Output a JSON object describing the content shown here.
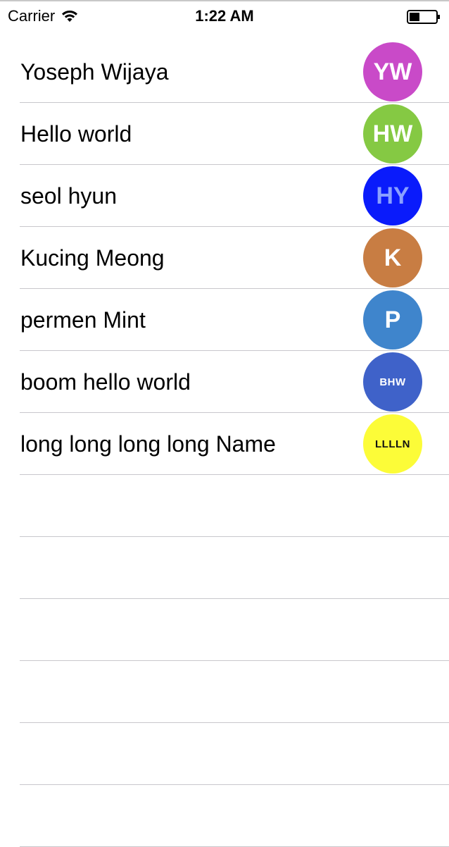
{
  "status_bar": {
    "carrier": "Carrier",
    "time": "1:22 AM"
  },
  "contacts": [
    {
      "name": "Yoseph Wijaya",
      "initials": "YW",
      "color": "#c94ac8"
    },
    {
      "name": "Hello world",
      "initials": "HW",
      "color": "#85c943"
    },
    {
      "name": "seol hyun",
      "initials": "HY",
      "color": "#0a1bfb"
    },
    {
      "name": "Kucing Meong",
      "initials": "K",
      "color": "#c87d43"
    },
    {
      "name": "permen Mint",
      "initials": "P",
      "color": "#3f85cc"
    },
    {
      "name": "boom hello world",
      "initials": "BHW",
      "color": "#3f62c9"
    },
    {
      "name": "long long long long Name",
      "initials": "LLLLN",
      "color": "#fcfc38"
    }
  ]
}
